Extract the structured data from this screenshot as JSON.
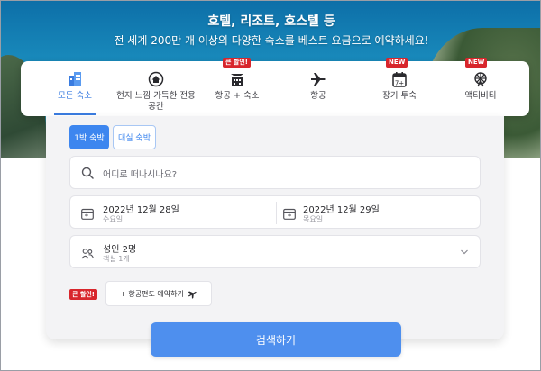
{
  "hero": {
    "title": "호텔, 리조트, 호스텔 등",
    "subtitle": "전 세계 200만 개 이상의 다양한 숙소를 베스트 요금으로 예약하세요!"
  },
  "tabs": [
    {
      "label": "모든 숙소",
      "icon": "building-icon",
      "active": true,
      "badge": ""
    },
    {
      "label": "현지 느낌 가득한 전용 공간",
      "icon": "home-icon",
      "active": false,
      "badge": ""
    },
    {
      "label": "항공 + 숙소",
      "icon": "flight-hotel-icon",
      "active": false,
      "badge": "큰 할인!"
    },
    {
      "label": "항공",
      "icon": "airplane-icon",
      "active": false,
      "badge": ""
    },
    {
      "label": "장기 투숙",
      "icon": "calendar-7-icon",
      "active": false,
      "badge": "NEW"
    },
    {
      "label": "액티비티",
      "icon": "ferris-wheel-icon",
      "active": false,
      "badge": "NEW"
    }
  ],
  "stay_type": {
    "overnight_label": "1박 숙박",
    "dayuse_label": "대실 숙박"
  },
  "search": {
    "destination_placeholder": "어디로 떠나시나요?",
    "checkin_date": "2022년 12월 28일",
    "checkin_day": "수요일",
    "checkout_date": "2022년 12월 29일",
    "checkout_day": "목요일",
    "guests_main": "성인 2명",
    "guests_sub": "객실 1개",
    "discount_badge": "큰 할인!",
    "add_flight_label": "+ 항공편도 예약하기",
    "submit_label": "검색하기"
  },
  "colors": {
    "accent": "#3d86ef",
    "badge_red": "#d8262c",
    "active_tab": "#3a7ce0"
  }
}
